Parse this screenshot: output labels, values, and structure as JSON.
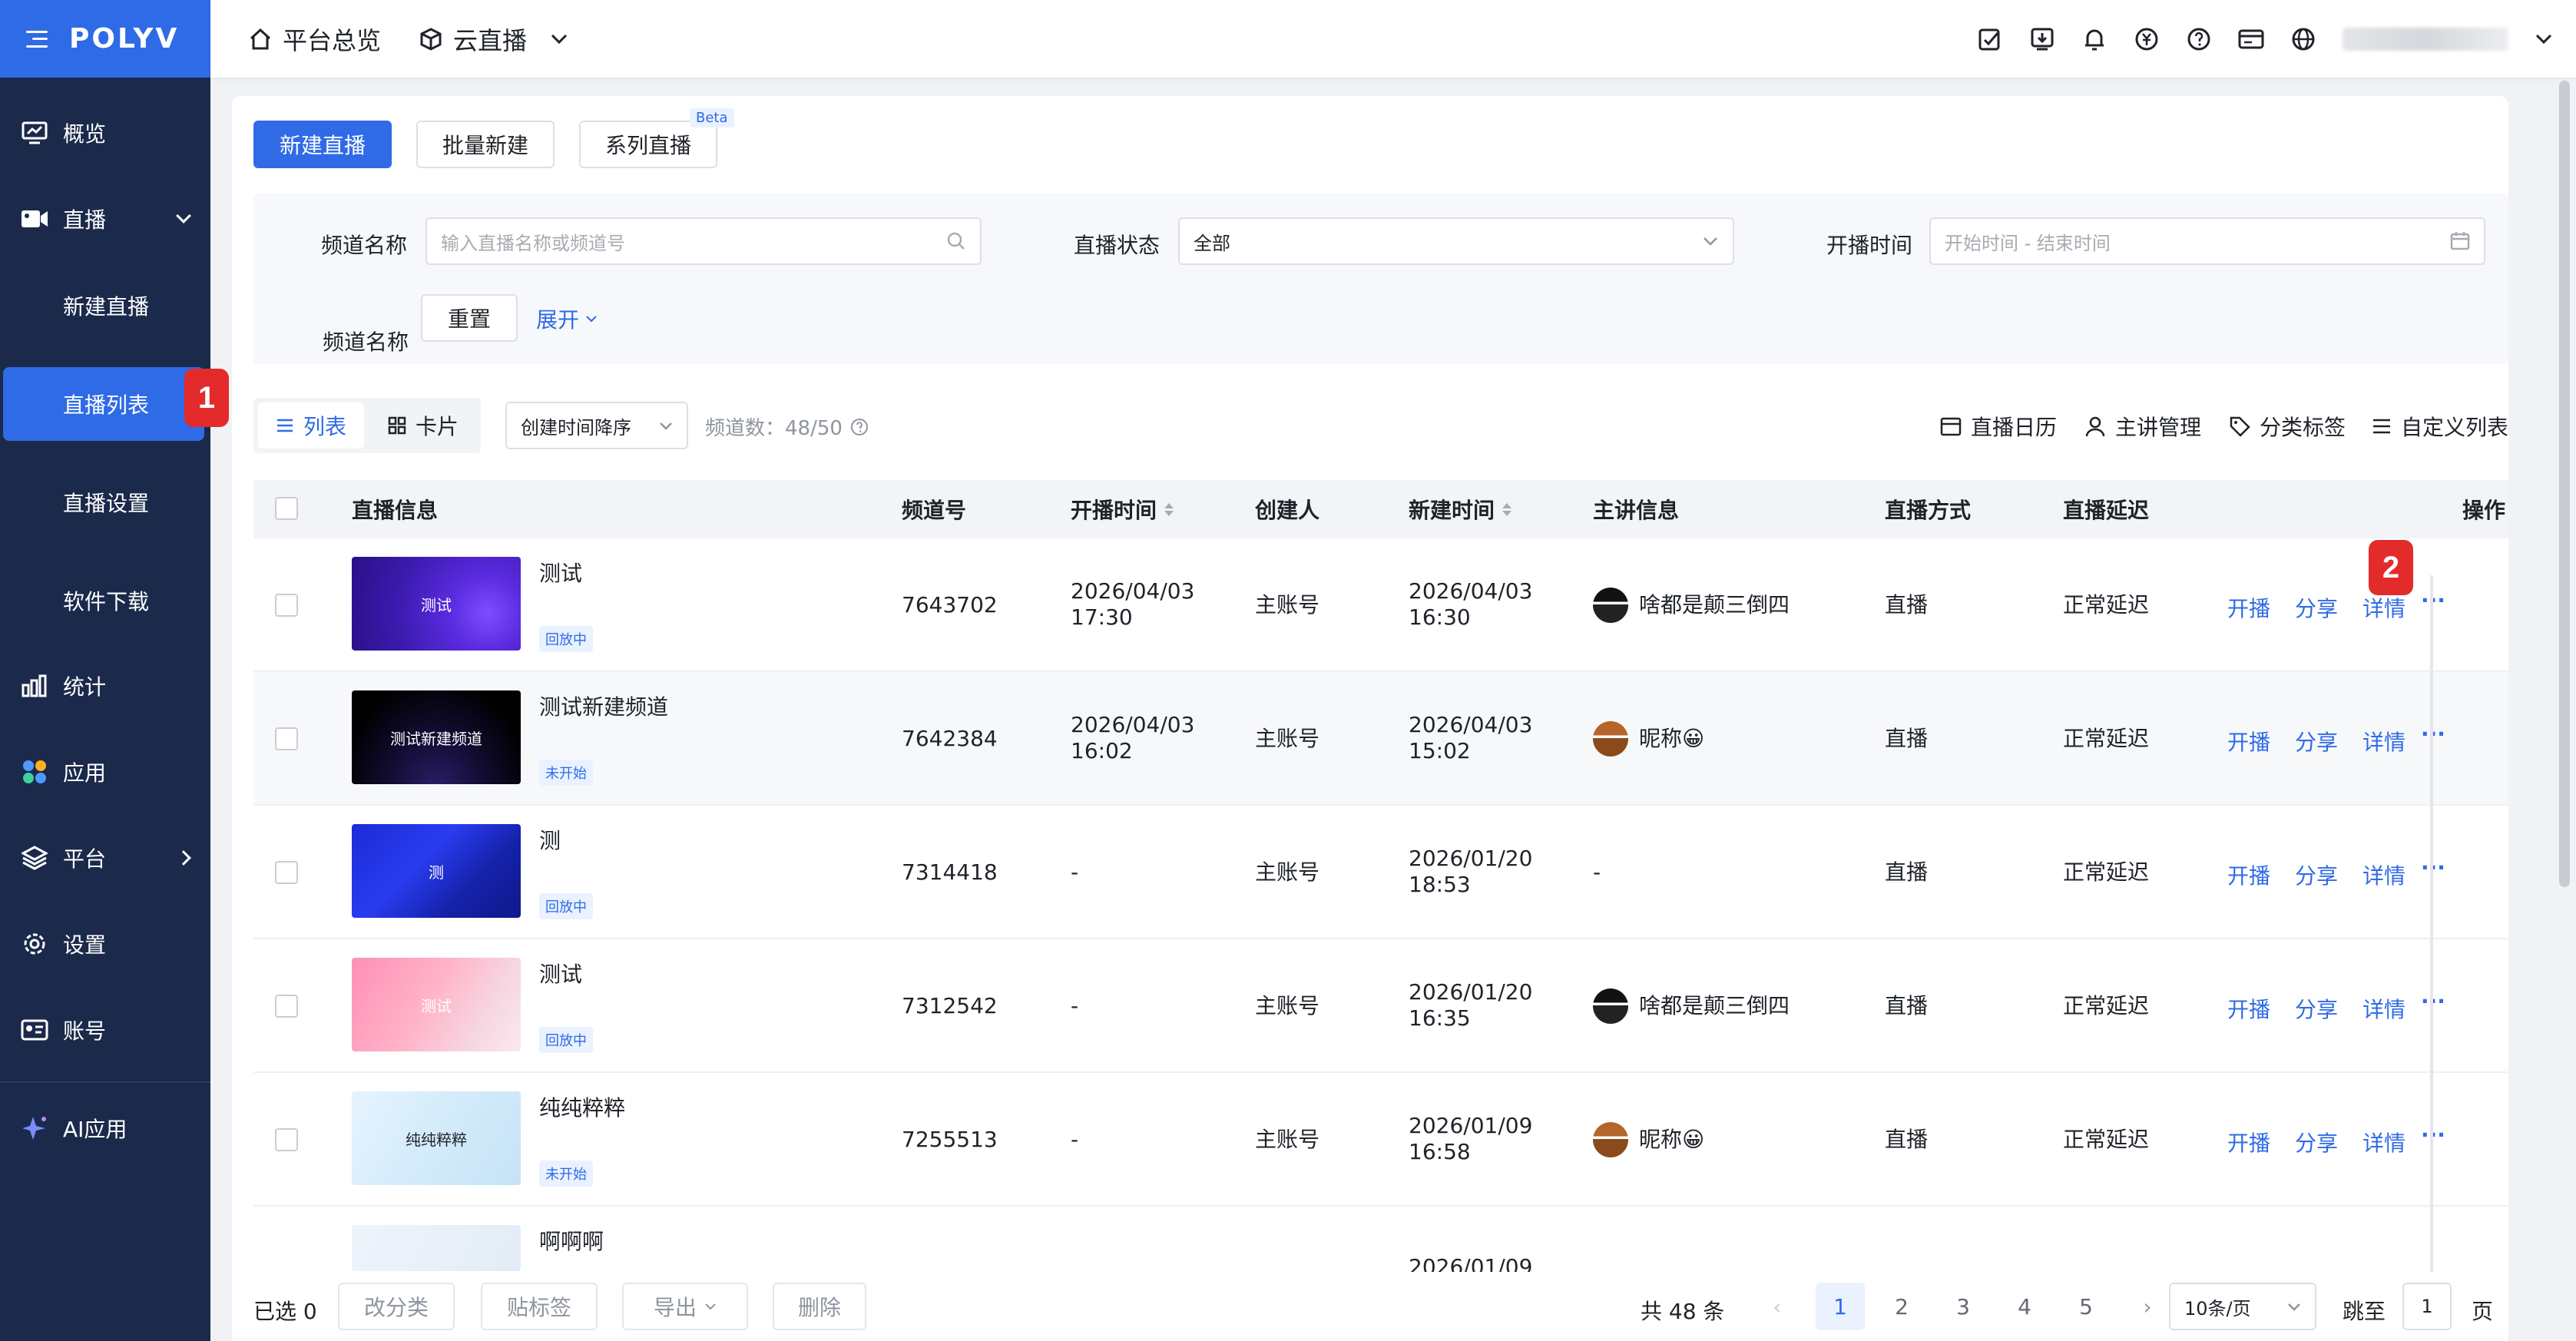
{
  "brand": {
    "logo": "POLYV"
  },
  "sidebar": {
    "items": [
      {
        "label": "概览",
        "icon": "monitor-icon"
      },
      {
        "label": "直播",
        "icon": "video-camera-icon"
      },
      {
        "label": "统计",
        "icon": "bar-chart-icon"
      },
      {
        "label": "应用",
        "icon": "apps-icon"
      },
      {
        "label": "平台",
        "icon": "layers-icon"
      },
      {
        "label": "设置",
        "icon": "gear-icon"
      },
      {
        "label": "账号",
        "icon": "id-card-icon"
      },
      {
        "label": "AI应用",
        "icon": "sparkle-icon"
      }
    ],
    "sub_items": [
      "新建直播",
      "直播列表",
      "直播设置",
      "软件下载"
    ],
    "badge_1": "1"
  },
  "topbar": {
    "home": "平台总览",
    "product": "云直播",
    "icons": [
      "checklist-icon",
      "download-icon",
      "bell-icon",
      "yen-icon",
      "help-icon",
      "card-icon",
      "globe-icon"
    ]
  },
  "actions": {
    "new_live": "新建直播",
    "batch_new": "批量新建",
    "series_live": "系列直播",
    "beta": "Beta"
  },
  "filters": {
    "channel_name_label": "频道名称",
    "channel_name_placeholder": "输入直播名称或频道号",
    "status_label": "直播状态",
    "status_value": "全部",
    "time_label": "开播时间",
    "time_placeholder": "开始时间 - 结束时间",
    "reset": "重置",
    "expand": "展开"
  },
  "toolbar": {
    "view_list": "列表",
    "view_card": "卡片",
    "sort": "创建时间降序",
    "channel_count": "频道数：48/50",
    "calendar": "直播日历",
    "lecturer": "主讲管理",
    "tags": "分类标签",
    "custom": "自定义列表"
  },
  "table": {
    "headers": [
      "直播信息",
      "频道号",
      "开播时间",
      "创建人",
      "新建时间",
      "主讲信息",
      "直播方式",
      "直播延迟",
      "操作"
    ],
    "rows": [
      {
        "thumb_text": "测试",
        "title": "测试",
        "status": "回放中",
        "channel": "7643702",
        "start1": "2026/04/03",
        "start2": "17:30",
        "creator": "主账号",
        "created1": "2026/04/03",
        "created2": "16:30",
        "lecturer": "啥都是颠三倒四",
        "mode": "直播",
        "delay": "正常延迟"
      },
      {
        "thumb_text": "测试新建频道",
        "title": "测试新建频道",
        "status": "未开始",
        "channel": "7642384",
        "start1": "2026/04/03",
        "start2": "16:02",
        "creator": "主账号",
        "created1": "2026/04/03",
        "created2": "15:02",
        "lecturer": "昵称😀",
        "mode": "直播",
        "delay": "正常延迟"
      },
      {
        "thumb_text": "测",
        "title": "测",
        "status": "回放中",
        "channel": "7314418",
        "start1": "-",
        "start2": "",
        "creator": "主账号",
        "created1": "2026/01/20",
        "created2": "18:53",
        "lecturer": "-",
        "mode": "直播",
        "delay": "正常延迟"
      },
      {
        "thumb_text": "测试",
        "title": "测试",
        "status": "回放中",
        "channel": "7312542",
        "start1": "-",
        "start2": "",
        "creator": "主账号",
        "created1": "2026/01/20",
        "created2": "16:35",
        "lecturer": "啥都是颠三倒四",
        "mode": "直播",
        "delay": "正常延迟"
      },
      {
        "thumb_text": "纯纯粹粹",
        "title": "纯纯粹粹",
        "status": "未开始",
        "channel": "7255513",
        "start1": "-",
        "start2": "",
        "creator": "主账号",
        "created1": "2026/01/09",
        "created2": "16:58",
        "lecturer": "昵称😀",
        "mode": "直播",
        "delay": "正常延迟"
      },
      {
        "title": "啊啊啊",
        "created1": "2026/01/09"
      }
    ],
    "ops": {
      "start": "开播",
      "share": "分享",
      "detail": "详情",
      "more": "···"
    },
    "badge_2": "2"
  },
  "footer": {
    "selected": "已选 0",
    "recategorize": "改分类",
    "tag": "贴标签",
    "export": "导出",
    "delete": "删除",
    "total": "共 48 条",
    "pages": [
      "1",
      "2",
      "3",
      "4",
      "5"
    ],
    "page_size": "10条/页",
    "jump_to": "跳至",
    "jump_value": "1",
    "page_unit": "页"
  },
  "colors": {
    "accent": "#2f6be6",
    "sidebar_bg": "#1b2a4b",
    "badge_red": "#e42b2b"
  }
}
